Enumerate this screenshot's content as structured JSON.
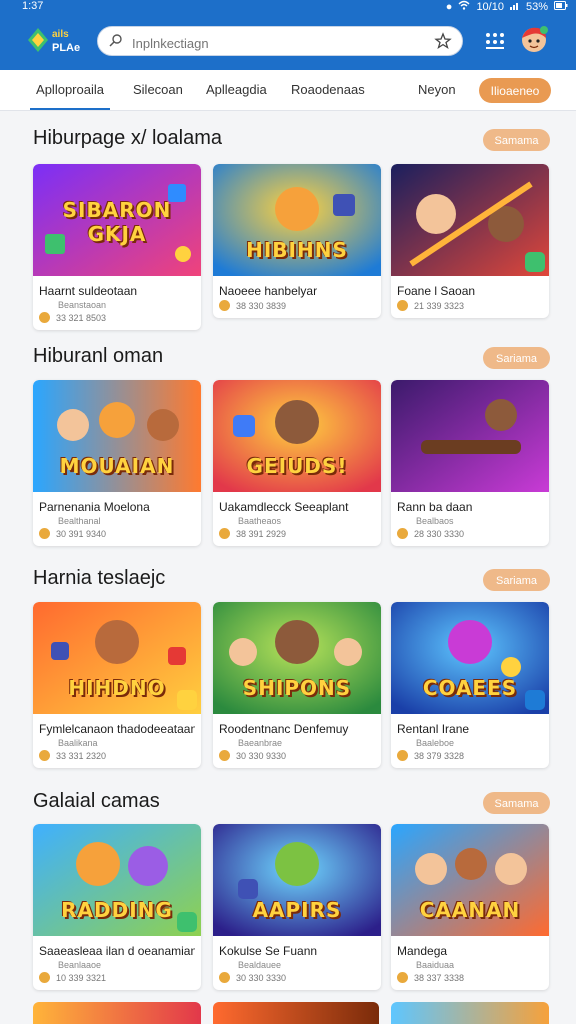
{
  "status": {
    "time": "1:37",
    "battery": "53%",
    "signal": "10/10"
  },
  "header": {
    "logo_text_1": "ails",
    "logo_text_2": "PLAe",
    "search_placeholder": "Inplnkectiagn"
  },
  "tabs": [
    {
      "label": "Aplloproaila"
    },
    {
      "label": "Silecoan"
    },
    {
      "label": "Aplleagdia"
    },
    {
      "label": "Roaodenaas"
    },
    {
      "label": "Neyon"
    }
  ],
  "tab_button": "Ilioaeneo",
  "colors": {
    "primary": "#1d6fc9",
    "accent": "#e99a52",
    "accent_light": "#efb989"
  },
  "sections": [
    {
      "title": "Hiburpage x/ loalama",
      "button": "Samama",
      "cards": [
        {
          "thumb_text": "SIBARON GKJA",
          "name": "Haarnt suldeotaan",
          "sub": "Beanstaoan",
          "meta": "33 321 8503"
        },
        {
          "thumb_text": "HIBIHNS",
          "name": "Naoeee hanbelyar",
          "sub": "",
          "meta": "38 330 3839"
        },
        {
          "thumb_text": "",
          "name": "Foane l Saoan",
          "sub": "",
          "meta": "21 339 3323"
        }
      ]
    },
    {
      "title": "Hiburanl oman",
      "button": "Sariama",
      "cards": [
        {
          "thumb_text": "MOUAIAN",
          "name": "Parnenania Moelona",
          "sub": "Bealthanal",
          "meta": "30 391 9340"
        },
        {
          "thumb_text": "GEIUDS!",
          "name": "Uakamdlecck Seeaplant",
          "sub": "Baatheaos",
          "meta": "38 391 2929"
        },
        {
          "thumb_text": "",
          "name": "Rann ba daan",
          "sub": "Bealbaos",
          "meta": "28 330 3330"
        }
      ]
    },
    {
      "title": "Harnia teslaejc",
      "button": "Sariama",
      "cards": [
        {
          "thumb_text": "HIHDNO",
          "name": "Fymlelcanaon thadodeeataan",
          "sub": "Baalikana",
          "meta": "33 331 2320"
        },
        {
          "thumb_text": "SHIPONS",
          "name": "Roodentnanc Denfemuy",
          "sub": "Baeanbrae",
          "meta": "30 330 9330"
        },
        {
          "thumb_text": "COAEES",
          "name": "Rentanl Irane",
          "sub": "Baaleboe",
          "meta": "38 379 3328"
        }
      ]
    },
    {
      "title": "Galaial camas",
      "button": "Samama",
      "cards": [
        {
          "thumb_text": "RADDING",
          "name": "Saaeasleaa ilan d oeanamian",
          "sub": "Beanlaaoe",
          "meta": "10 339 3321"
        },
        {
          "thumb_text": "AAPIRS",
          "name": "Kokulse Se Fuann",
          "sub": "Bealdauee",
          "meta": "30 330 3330"
        },
        {
          "thumb_text": "CAANAN",
          "name": "Mandega",
          "sub": "Baaiduaa",
          "meta": "38 337 3338"
        }
      ]
    }
  ]
}
